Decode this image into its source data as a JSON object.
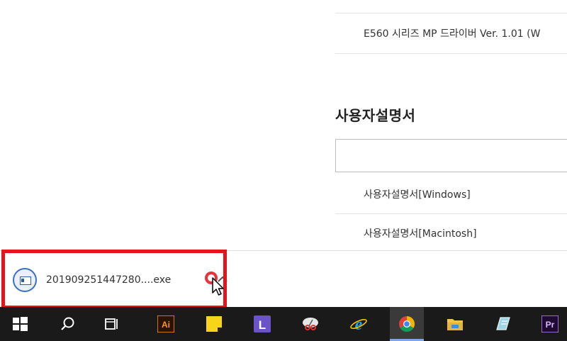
{
  "page": {
    "driver_row": "E560 시리즈 MP 드라이버 Ver. 1.01 (W",
    "manual_section_title": "사용자설명서",
    "search_value": "",
    "manual_windows": "사용자설명서[Windows]",
    "manual_macintosh": "사용자설명서[Macintosh]"
  },
  "download_bar": {
    "file_name": "201909251447280....exe",
    "file_icon": "windows-installer-icon",
    "menu_icon": "chevron-up-icon",
    "highlight_color": "#e5141a"
  },
  "taskbar": {
    "items": [
      {
        "name": "start",
        "icon": "windows-logo-icon"
      },
      {
        "name": "search",
        "icon": "search-icon"
      },
      {
        "name": "task-view",
        "icon": "task-view-icon"
      },
      {
        "name": "illustrator",
        "icon": "illustrator-icon",
        "label": "Ai"
      },
      {
        "name": "sticky-notes",
        "icon": "sticky-notes-icon"
      },
      {
        "name": "app-l",
        "icon": "l-app-icon",
        "label": "L"
      },
      {
        "name": "snipping-tool",
        "icon": "snipping-tool-icon"
      },
      {
        "name": "internet-explorer",
        "icon": "internet-explorer-icon",
        "label": "e"
      },
      {
        "name": "chrome",
        "icon": "chrome-icon"
      },
      {
        "name": "file-explorer",
        "icon": "folder-icon"
      },
      {
        "name": "notes-app",
        "icon": "notes-app-icon"
      },
      {
        "name": "premiere",
        "icon": "premiere-icon",
        "label": "Pr"
      }
    ]
  }
}
